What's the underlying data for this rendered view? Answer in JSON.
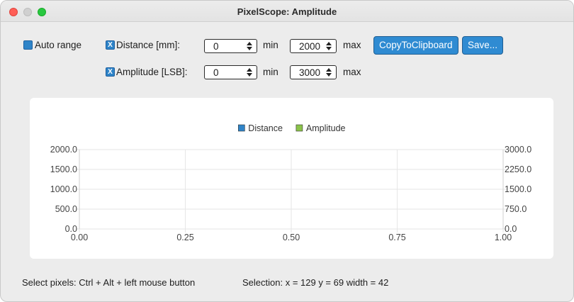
{
  "window": {
    "title": "PixelScope: Amplitude"
  },
  "controls": {
    "auto_range": {
      "label": "Auto range",
      "checked": false
    },
    "distance": {
      "label": "Distance  [mm]:",
      "checked": true,
      "check_mark": "X",
      "min": "0",
      "max": "2000",
      "min_label": "min",
      "max_label": "max"
    },
    "amplitude": {
      "label": "Amplitude [LSB]:",
      "checked": true,
      "check_mark": "X",
      "min": "0",
      "max": "3000",
      "min_label": "min",
      "max_label": "max"
    },
    "copy_button": "CopyToClipboard",
    "save_button": "Save..."
  },
  "chart_data": {
    "type": "line",
    "legend_position": "top-center",
    "series": [
      {
        "name": "Distance",
        "color": "#2f84c8",
        "values": []
      },
      {
        "name": "Amplitude",
        "color": "#8bc34a",
        "values": []
      }
    ],
    "x_ticks": [
      "0.00",
      "0.25",
      "0.50",
      "0.75",
      "1.00"
    ],
    "y_left_ticks": [
      "0.0",
      "500.0",
      "1000.0",
      "1500.0",
      "2000.0"
    ],
    "y_right_ticks": [
      "0.0",
      "750.0",
      "1500.0",
      "2250.0",
      "3000.0"
    ],
    "xlim": [
      0,
      1
    ],
    "ylim_left": [
      0,
      2000
    ],
    "ylim_right": [
      0,
      3000
    ],
    "grid": true
  },
  "status": {
    "hint": "Select pixels: Ctrl + Alt + left mouse button",
    "selection": "Selection: x = 129  y = 69  width = 42"
  }
}
